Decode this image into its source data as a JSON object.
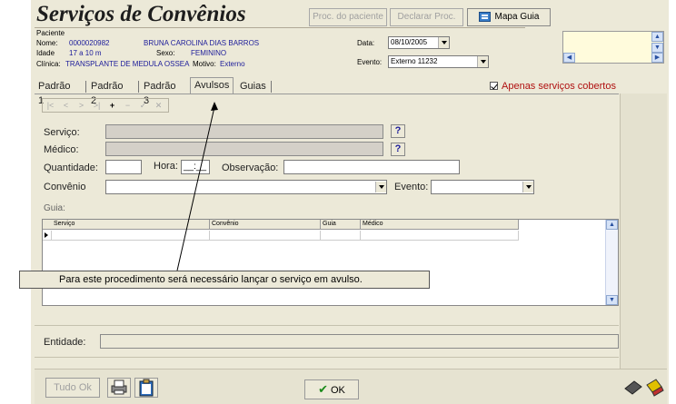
{
  "window": {
    "title": "Serviços de Convênios"
  },
  "toolbar": {
    "proc_paciente": "Proc. do paciente",
    "declarar_proc": "Declarar Proc.",
    "mapa_guia": "Mapa Guia"
  },
  "patient": {
    "section_label": "Paciente",
    "nome_label": "Nome:",
    "nome_code": "0000020982",
    "nome_value": "BRUNA CAROLINA DIAS BARROS",
    "idade_label": "Idade",
    "idade_value": "17 a 10 m",
    "sexo_label": "Sexo:",
    "sexo_value": "FEMININO",
    "clinica_label": "Clínica:",
    "clinica_value": "TRANSPLANTE DE MEDULA OSSEA",
    "motivo_label": "Motivo:",
    "motivo_value": "Externo",
    "data_label": "Data:",
    "data_value": "08/10/2005",
    "evento_label": "Evento:",
    "evento_value": "Externo 11232"
  },
  "tabs": [
    {
      "label": "Padrão 1"
    },
    {
      "label": "Padrão 2"
    },
    {
      "label": "Padrão 3"
    },
    {
      "label": "Avulsos"
    },
    {
      "label": "Guias"
    }
  ],
  "apenas_label": "Apenas serviços cobertos",
  "form": {
    "servico_label": "Serviço:",
    "medico_label": "Médico:",
    "quantidade_label": "Quantidade:",
    "hora_label": "Hora:",
    "hora_value": "__:__",
    "observacao_label": "Observação:",
    "convenio_label": "Convênio",
    "evento_label": "Evento:",
    "guia_label": "Guia:",
    "lookup_label": "?"
  },
  "nav_buttons": [
    "|<",
    "<",
    ">",
    ">|",
    "+",
    "−",
    "✓",
    "✕"
  ],
  "grid": {
    "columns": [
      "Serviço",
      "Convênio",
      "Guia",
      "Médico"
    ]
  },
  "callout_text": "Para este procedimento será necessário lançar o serviço em avulso.",
  "entidade_label": "Entidade:",
  "footer": {
    "tudo_ok": "Tudo Ok",
    "ok": "OK"
  },
  "colors": {
    "window_bg": "#ece9d8",
    "value_blue": "#1c1c9a",
    "apenas_red": "#b01010"
  }
}
